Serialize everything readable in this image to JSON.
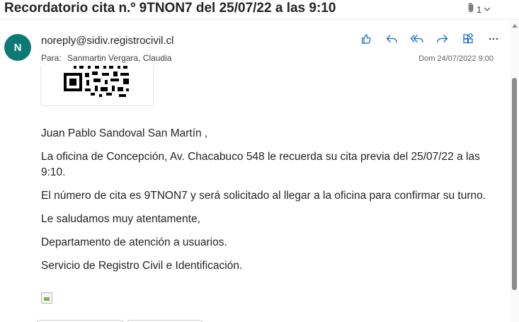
{
  "subject": "Recordatorio cita n.º 9TNON7 del 25/07/22 a las 9:10",
  "attachment_count": "1",
  "sender": {
    "initial": "N",
    "avatar_color": "#0b7a75",
    "email": "noreply@sidiv.registrocivil.cl"
  },
  "recipient": {
    "label": "Para:",
    "name": "Sanmartin Vergara, Claudia"
  },
  "date": "Dom 24/07/2022 9:00",
  "actions": [
    "thumbs-up-icon",
    "reply-icon",
    "reply-all-icon",
    "forward-icon",
    "apps-icon",
    "more-icon"
  ],
  "body": {
    "greeting": "Juan Pablo Sandoval San Martín ,",
    "para1": "La oficina de Concepción, Av. Chacabuco 548 le recuerda su cita previa del 25/07/22 a las 9:10.",
    "para2": "El número de cita es 9TNON7 y será solicitado al llegar a la oficina para confirmar su turno.",
    "closing": "Le saludamos muy atentamente,",
    "department": "Departamento de atención a usuarios.",
    "service": "Servicio de Registro Civil e Identificación."
  },
  "accent_color": "#0f6cbd"
}
